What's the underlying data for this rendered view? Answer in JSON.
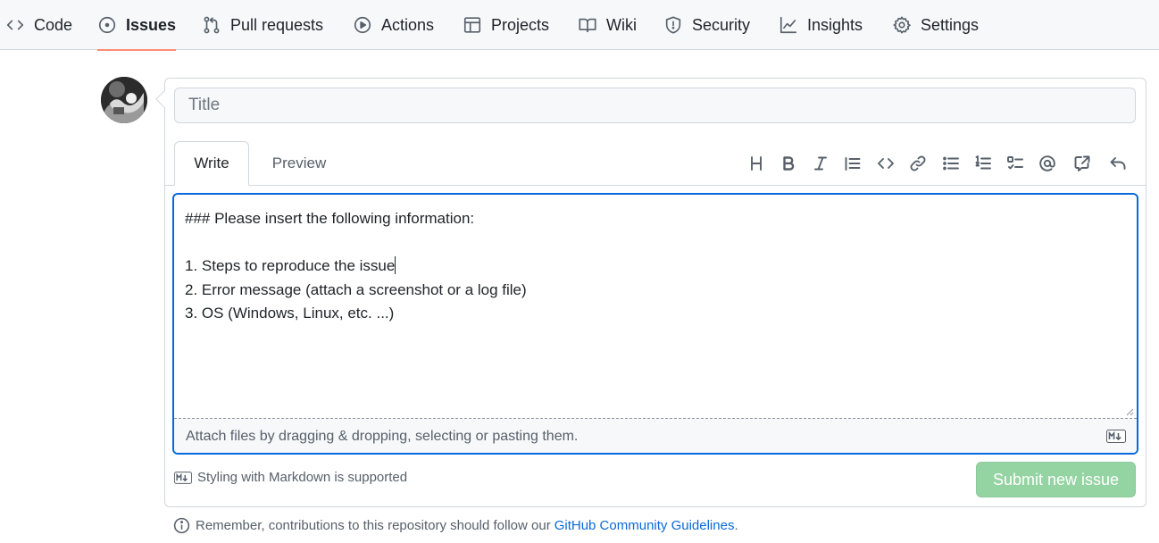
{
  "nav": {
    "tabs": [
      {
        "label": "Code",
        "icon": "code-icon"
      },
      {
        "label": "Issues",
        "icon": "issue-opened-icon",
        "active": true
      },
      {
        "label": "Pull requests",
        "icon": "git-pull-request-icon"
      },
      {
        "label": "Actions",
        "icon": "play-icon"
      },
      {
        "label": "Projects",
        "icon": "table-icon"
      },
      {
        "label": "Wiki",
        "icon": "book-icon"
      },
      {
        "label": "Security",
        "icon": "shield-icon"
      },
      {
        "label": "Insights",
        "icon": "graph-icon"
      },
      {
        "label": "Settings",
        "icon": "gear-icon"
      }
    ]
  },
  "form": {
    "title_placeholder": "Title",
    "tabs": {
      "write": "Write",
      "preview": "Preview"
    },
    "toolbar": [
      "heading-icon",
      "bold-icon",
      "italic-icon",
      "quote-icon",
      "code-icon",
      "link-icon",
      "unordered-list-icon",
      "ordered-list-icon",
      "task-list-icon",
      "mention-icon",
      "cross-reference-icon",
      "reply-icon"
    ],
    "body_lines": [
      "### Please insert the following information:",
      "",
      "1. Steps to reproduce the issue",
      "2. Error message (attach a screenshot or a log file)",
      "3. OS (Windows, Linux, etc. ...)"
    ],
    "attach_hint": "Attach files by dragging & dropping, selecting or pasting them.",
    "markdown_note": "Styling with Markdown is supported",
    "submit_label": "Submit new issue"
  },
  "footer": {
    "note": "Remember, contributions to this repository should follow our",
    "link": "GitHub Community Guidelines",
    "suffix": "."
  },
  "colors": {
    "accent": "#0969da",
    "active_tab_underline": "#fd8c73",
    "submit_disabled": "#94d3a2"
  }
}
